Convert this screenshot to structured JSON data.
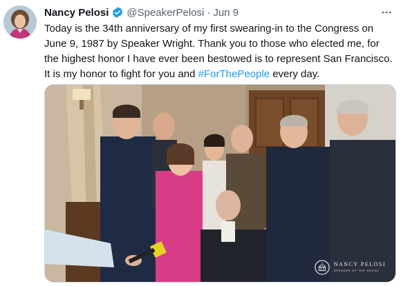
{
  "tweet": {
    "author": {
      "display_name": "Nancy Pelosi",
      "handle": "@SpeakerPelosi",
      "verified": true
    },
    "separator": "·",
    "date": "Jun 9",
    "more_icon": "more-horizontal-icon",
    "text_main": "Today is the 34th anniversary of my first swearing-in to the Congress on June 9, 1987 by Speaker Wright. Thank you to those who elected me, for the highest honor I have ever been bestowed is to represent San Francisco. It is my honor to fight for you and ",
    "hashtag": "#ForThePeople",
    "text_tail": " every day.",
    "media": {
      "watermark_name": "NANCY PELOSI",
      "watermark_sub": "SPEAKER OF THE HOUSE"
    }
  },
  "colors": {
    "link": "#1d9bf0",
    "verified": "#1d9bf0",
    "secondary_text": "#536471"
  }
}
